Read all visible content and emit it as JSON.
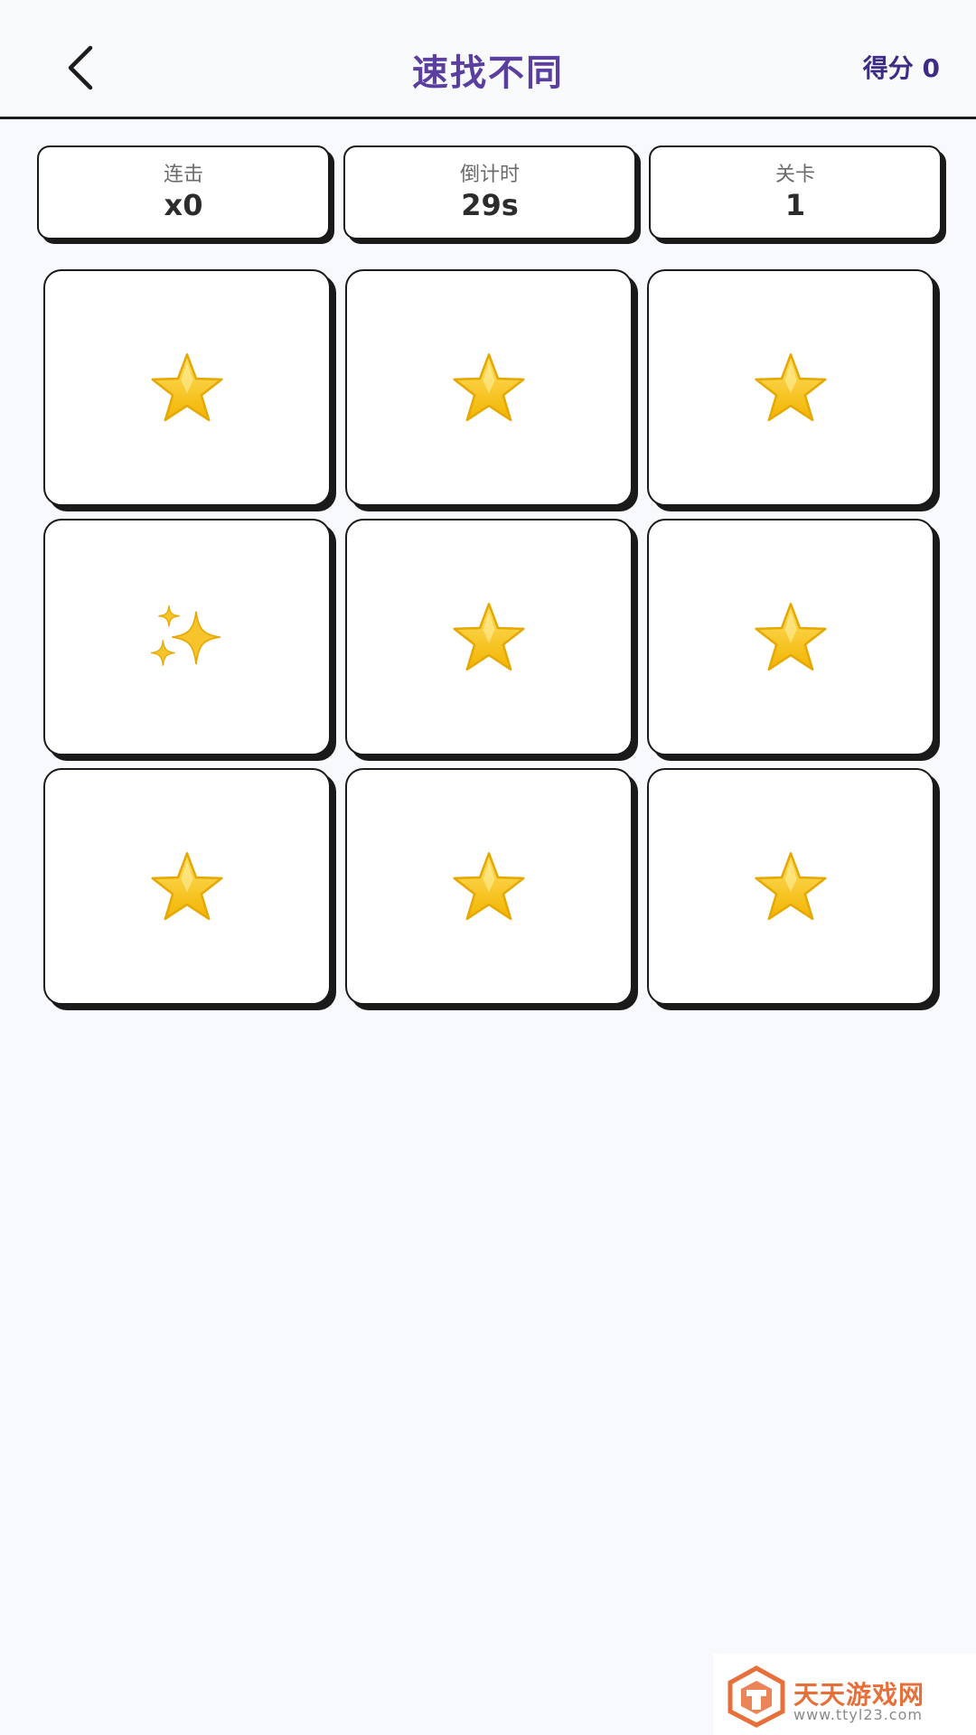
{
  "header": {
    "back_icon": "chevron-left-icon",
    "title": "速找不同",
    "score": "得分 0"
  },
  "stats": [
    {
      "label": "连击",
      "value": "x0"
    },
    {
      "label": "倒计时",
      "value": "29s"
    },
    {
      "label": "关卡",
      "value": "1"
    }
  ],
  "grid": {
    "rows": 3,
    "cols": 3,
    "cells": [
      {
        "icon": "star-icon"
      },
      {
        "icon": "star-icon"
      },
      {
        "icon": "star-icon"
      },
      {
        "icon": "sparkles-icon"
      },
      {
        "icon": "star-icon"
      },
      {
        "icon": "star-icon"
      },
      {
        "icon": "star-icon"
      },
      {
        "icon": "star-icon"
      },
      {
        "icon": "star-icon"
      }
    ]
  },
  "colors": {
    "title": "#5a3fa0",
    "score": "#3d2b86",
    "star": "#f7c52b",
    "border": "#1a1a1a"
  },
  "watermark": {
    "text": "天天游戏网",
    "url": "www.ttyl23.com"
  }
}
